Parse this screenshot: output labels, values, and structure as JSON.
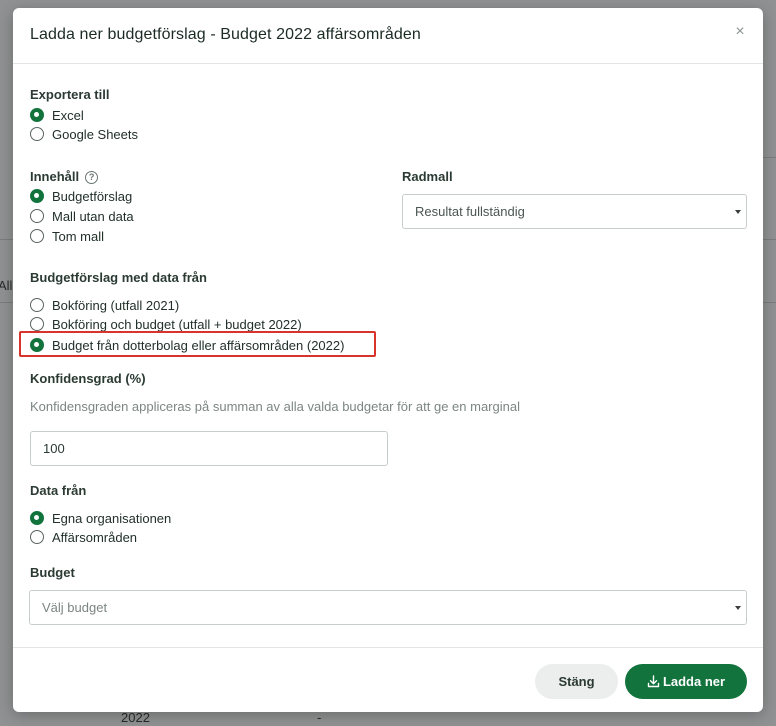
{
  "background": {
    "year_text": "2022",
    "dash_text": "-",
    "left_fragment": "Allu"
  },
  "modal": {
    "title": "Ladda ner budgetförslag - Budget 2022 affärsområden",
    "close_label": "×"
  },
  "export": {
    "label": "Exportera till",
    "options": [
      {
        "label": "Excel",
        "checked": true
      },
      {
        "label": "Google Sheets",
        "checked": false
      }
    ]
  },
  "content": {
    "label": "Innehåll",
    "help_icon_text": "?",
    "options": [
      {
        "label": "Budgetförslag",
        "checked": true
      },
      {
        "label": "Mall utan data",
        "checked": false
      },
      {
        "label": "Tom mall",
        "checked": false
      }
    ]
  },
  "row_template": {
    "label": "Radmall",
    "selected": "Resultat fullständig"
  },
  "data_source": {
    "label": "Budgetförslag med data från",
    "options": [
      {
        "label": "Bokföring (utfall 2021)",
        "checked": false
      },
      {
        "label": "Bokföring och budget (utfall + budget 2022)",
        "checked": false
      },
      {
        "label": "Budget från dotterbolag eller affärsområden (2022)",
        "checked": true
      }
    ]
  },
  "confidence": {
    "label": "Konfidensgrad (%)",
    "helper": "Konfidensgraden appliceras på summan av alla valda budgetar för att ge en marginal",
    "value": "100"
  },
  "data_from": {
    "label": "Data från",
    "options": [
      {
        "label": "Egna organisationen",
        "checked": true
      },
      {
        "label": "Affärsområden",
        "checked": false
      }
    ]
  },
  "budget": {
    "label": "Budget",
    "placeholder": "Välj budget"
  },
  "footer": {
    "close_label": "Stäng",
    "download_label": "Ladda ner"
  },
  "colors": {
    "accent": "#12733d",
    "highlight": "#d8342c"
  }
}
